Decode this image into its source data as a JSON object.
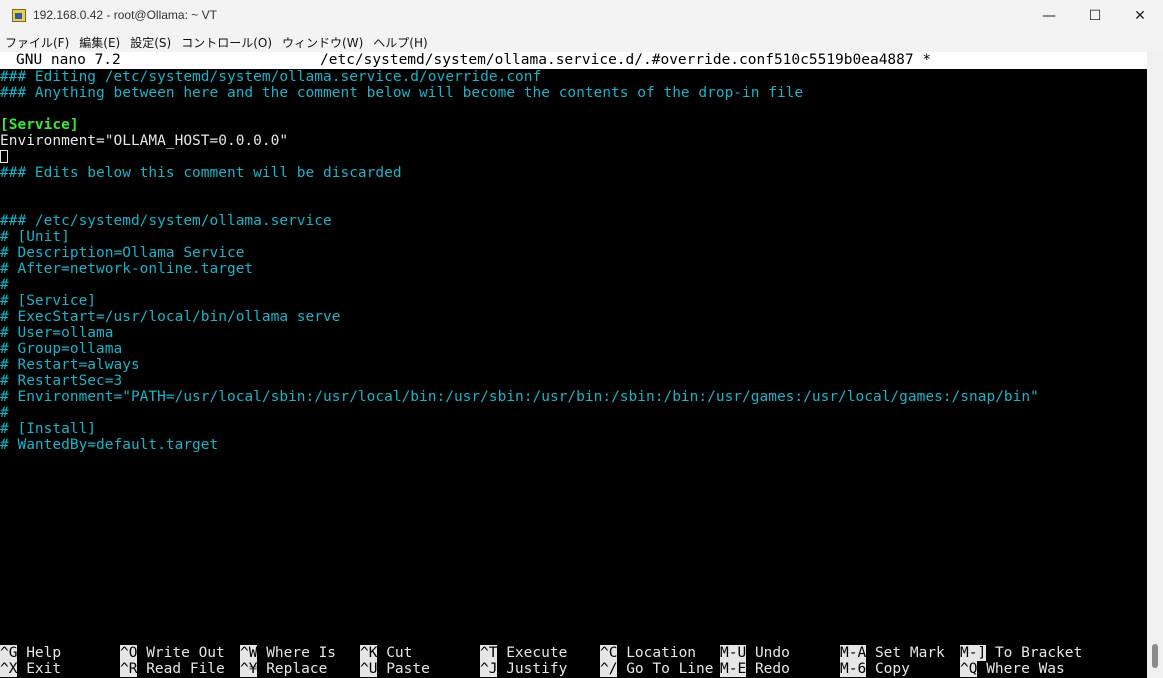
{
  "window": {
    "title": "192.168.0.42 - root@Ollama: ~ VT",
    "minimize_glyph": "—",
    "maximize_glyph": "☐",
    "close_glyph": "✕"
  },
  "menu": [
    "ファイル(F)",
    "編集(E)",
    "設定(S)",
    "コントロール(O)",
    "ウィンドウ(W)",
    "ヘルプ(H)"
  ],
  "nano": {
    "version": "GNU nano 7.2",
    "filename": "/etc/systemd/system/ollama.service.d/.#override.conf510c5519b0ea4887 *"
  },
  "content": {
    "line1": "### Editing /etc/systemd/system/ollama.service.d/override.conf",
    "line2": "### Anything between here and the comment below will become the contents of the drop-in file",
    "line4": "[Service]",
    "line5": "Environment=\"OLLAMA_HOST=0.0.0.0\"",
    "line7": "### Edits below this comment will be discarded",
    "line10": "### /etc/systemd/system/ollama.service",
    "line11": "# [Unit]",
    "line12": "# Description=Ollama Service",
    "line13": "# After=network-online.target",
    "line14": "#",
    "line15": "# [Service]",
    "line16": "# ExecStart=/usr/local/bin/ollama serve",
    "line17": "# User=ollama",
    "line18": "# Group=ollama",
    "line19": "# Restart=always",
    "line20": "# RestartSec=3",
    "line21": "# Environment=\"PATH=/usr/local/sbin:/usr/local/bin:/usr/sbin:/usr/bin:/sbin:/bin:/usr/games:/usr/local/games:/snap/bin\"",
    "line22": "#",
    "line23": "# [Install]",
    "line24": "# WantedBy=default.target"
  },
  "shortcuts": {
    "row1": [
      {
        "key": "^G",
        "label": "Help"
      },
      {
        "key": "^O",
        "label": "Write Out"
      },
      {
        "key": "^W",
        "label": "Where Is"
      },
      {
        "key": "^K",
        "label": "Cut"
      },
      {
        "key": "^T",
        "label": "Execute"
      },
      {
        "key": "^C",
        "label": "Location"
      },
      {
        "key": "M-U",
        "label": "Undo"
      },
      {
        "key": "M-A",
        "label": "Set Mark"
      },
      {
        "key": "M-]",
        "label": "To Bracket"
      }
    ],
    "row2": [
      {
        "key": "^X",
        "label": "Exit"
      },
      {
        "key": "^R",
        "label": "Read File"
      },
      {
        "key": "^¥",
        "label": "Replace"
      },
      {
        "key": "^U",
        "label": "Paste"
      },
      {
        "key": "^J",
        "label": "Justify"
      },
      {
        "key": "^/",
        "label": "Go To Line"
      },
      {
        "key": "M-E",
        "label": "Redo"
      },
      {
        "key": "M-6",
        "label": "Copy"
      },
      {
        "key": "^Q",
        "label": "Where Was"
      }
    ]
  },
  "colors": {
    "comment": "#1ab3c8",
    "section": "#38e838",
    "text": "#e6e6e6",
    "background": "#000000"
  }
}
